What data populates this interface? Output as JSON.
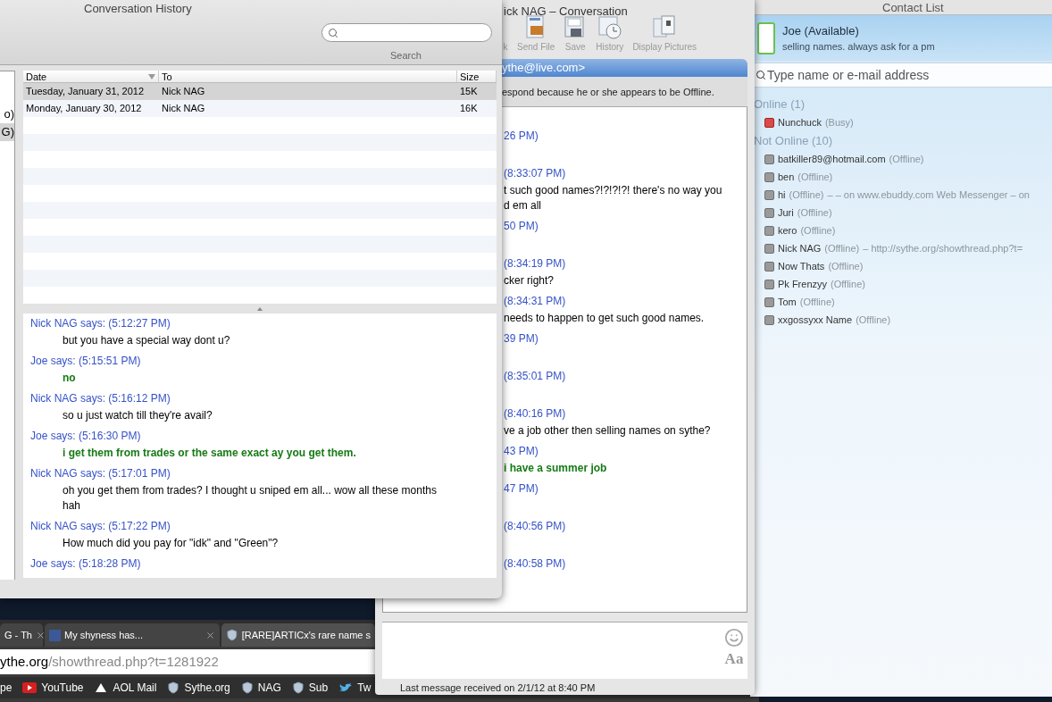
{
  "history_window": {
    "title": "Conversation History",
    "search": {
      "label": "Search"
    },
    "sidebar_items": [
      {
        "text": "o)",
        "selected": false
      },
      {
        "text": "G)",
        "selected": true
      }
    ],
    "table": {
      "columns": [
        "Date",
        "To",
        "Size"
      ],
      "rows": [
        {
          "date": "Tuesday, January 31, 2012",
          "to": "Nick NAG",
          "size": "15K",
          "selected": true
        },
        {
          "date": "Monday, January 30, 2012",
          "to": "Nick NAG",
          "size": "16K",
          "selected": false
        }
      ]
    },
    "transcript": [
      {
        "header": "Nick NAG says: (5:12:27 PM)",
        "kind": "them",
        "lines": [
          "but you have a special way dont u?"
        ]
      },
      {
        "header": "Joe says: (5:15:51 PM)",
        "kind": "me",
        "lines": [
          "no"
        ]
      },
      {
        "header": "Nick NAG says: (5:16:12 PM)",
        "kind": "them",
        "lines": [
          "so u just watch till they're avail?"
        ]
      },
      {
        "header": "Joe says: (5:16:30 PM)",
        "kind": "me",
        "lines": [
          "i get them from trades or the same exact ay you get them."
        ]
      },
      {
        "header": "Nick NAG says: (5:17:01 PM)",
        "kind": "them",
        "lines": [
          "oh you get them from trades? I thought u sniped em all... wow all these months",
          "hah"
        ]
      },
      {
        "header": "Nick NAG says: (5:17:22 PM)",
        "kind": "them",
        "lines": [
          "How much did you pay for \"idk\" and \"Green\"?"
        ]
      },
      {
        "header": "Joe says: (5:18:28 PM)"
      }
    ]
  },
  "conversation_window": {
    "title": "ick NAG – Conversation",
    "toolbar": [
      {
        "label": "k",
        "kind": "partial"
      },
      {
        "label": "Send File",
        "kind": "send_file"
      },
      {
        "label": "Save",
        "kind": "save"
      },
      {
        "label": "History",
        "kind": "history"
      },
      {
        "label": "Display Pictures",
        "kind": "pictures"
      }
    ],
    "contact_header": "ythe@live.com>",
    "notice": "espond because he or she appears to be Offline.",
    "messages": [
      {
        "header": "26 PM)"
      },
      {
        "header": "(8:33:07 PM)",
        "kind": "them",
        "lines": [
          "t such good names?!?!?!?! there's no way you",
          "d em all"
        ]
      },
      {
        "header": "50 PM)"
      },
      {
        "header": "(8:34:19 PM)",
        "kind": "them",
        "lines": [
          "cker right?"
        ]
      },
      {
        "header": "(8:34:31 PM)",
        "kind": "them",
        "lines": [
          "needs to happen to get such good names."
        ]
      },
      {
        "header": "39 PM)"
      },
      {
        "header": "(8:35:01 PM)"
      },
      {
        "header": "(8:40:16 PM)",
        "kind": "them",
        "lines": [
          "ve a job other then selling names on sythe?"
        ]
      },
      {
        "header": "43 PM)",
        "kind": "me",
        "lines": [
          "i have a summer job"
        ]
      },
      {
        "header": "47 PM)"
      },
      {
        "header": "(8:40:56 PM)"
      },
      {
        "header": "(8:40:58 PM)"
      }
    ],
    "font_button": "Aa",
    "status": "Last message received on 2/1/12 at 8:40 PM"
  },
  "contact_list": {
    "title": "Contact List",
    "user": {
      "name": "Joe (Available)",
      "message": "selling names. always ask for a pm"
    },
    "search": {
      "placeholder": "Type name or e-mail address"
    },
    "groups": [
      {
        "name": "Online (1)",
        "contacts": [
          {
            "name": "Nunchuck",
            "status": "(Busy)",
            "kind": "busy"
          }
        ]
      },
      {
        "name": "Not Online (10)",
        "contacts": [
          {
            "name": "batkiller89@hotmail.com",
            "status": "(Offline)",
            "kind": "offline"
          },
          {
            "name": "ben",
            "status": "(Offline)",
            "kind": "offline"
          },
          {
            "name": "hi",
            "status": "(Offline)",
            "note": "– – on www.ebuddy.com Web Messenger – on",
            "kind": "offline"
          },
          {
            "name": "Juri",
            "status": "(Offline)",
            "kind": "offline"
          },
          {
            "name": "kero",
            "status": "(Offline)",
            "kind": "offline"
          },
          {
            "name": "Nick NAG",
            "status": "(Offline)",
            "note": "– http://sythe.org/showthread.php?t=",
            "kind": "offline"
          },
          {
            "name": "Now Thats",
            "status": "(Offline)",
            "kind": "offline"
          },
          {
            "name": "Pk Frenzyy",
            "status": "(Offline)",
            "kind": "offline"
          },
          {
            "name": "Tom",
            "status": "(Offline)",
            "kind": "offline"
          },
          {
            "name": "xxgossyxx Name",
            "status": "(Offline)",
            "kind": "offline"
          }
        ]
      }
    ]
  },
  "browser": {
    "tabs": [
      {
        "title": "G - Th",
        "kind": "plain",
        "selected": false
      },
      {
        "title": "My shyness has...",
        "kind": "facebook",
        "selected": false
      },
      {
        "title": "[RARE]ARTICx's rare name s",
        "kind": "shield",
        "selected": true
      }
    ],
    "url": {
      "host": "ythe.org",
      "path": "/showthread.php?t=1281922"
    },
    "bookmarks": [
      {
        "label": "pe",
        "kind": "plain"
      },
      {
        "label": "YouTube",
        "kind": "youtube"
      },
      {
        "label": "AOL Mail",
        "kind": "aol"
      },
      {
        "label": "Sythe.org",
        "kind": "shield"
      },
      {
        "label": "NAG",
        "kind": "shield"
      },
      {
        "label": "Sub",
        "kind": "shield"
      },
      {
        "label": "Tw",
        "kind": "twitter"
      }
    ]
  }
}
